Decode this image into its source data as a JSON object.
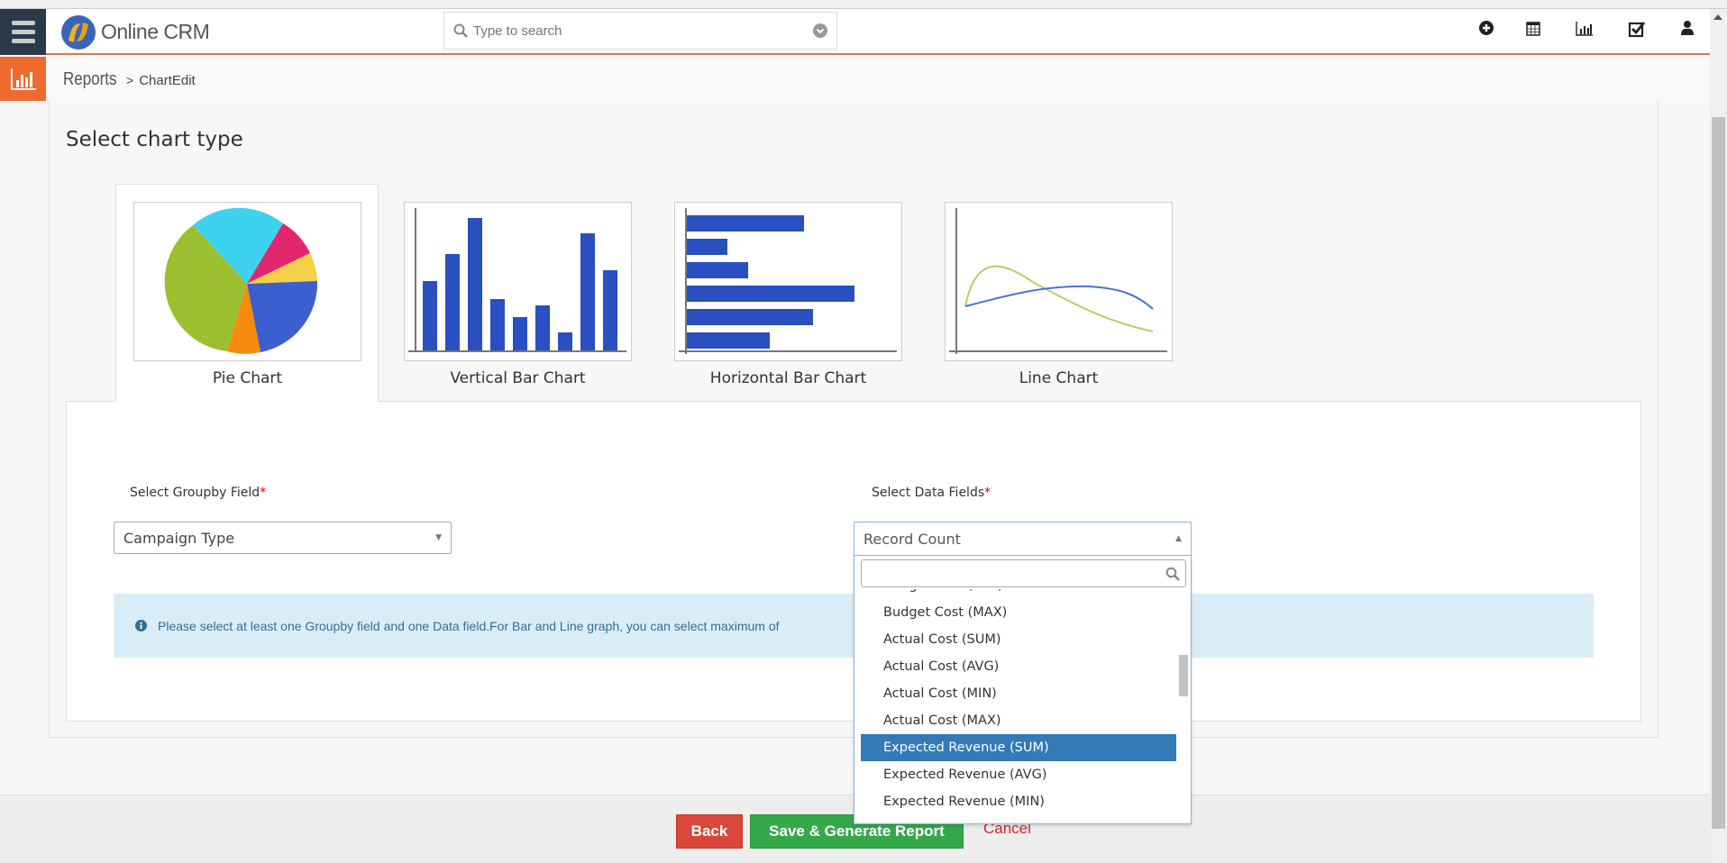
{
  "header": {
    "logo_text": "Online CRM",
    "search_placeholder": "Type to search",
    "icons": [
      "plus-circle-icon",
      "calendar-icon",
      "bar-chart-icon",
      "checkbox-icon",
      "user-icon"
    ]
  },
  "breadcrumb": {
    "root": "Reports",
    "separator": ">",
    "current": "ChartEdit"
  },
  "page": {
    "title": "Select chart type"
  },
  "chart_types": [
    {
      "label": "Pie Chart",
      "active": true
    },
    {
      "label": "Vertical Bar Chart",
      "active": false
    },
    {
      "label": "Horizontal Bar Chart",
      "active": false
    },
    {
      "label": "Line Chart",
      "active": false
    }
  ],
  "form": {
    "groupby_label": "Select Groupby Field",
    "groupby_value": "Campaign Type",
    "data_label": "Select Data Fields",
    "data_value": "Record Count",
    "required_mark": "*",
    "search_value": "",
    "options": [
      "Budget Cost (MIN)",
      "Budget Cost (MAX)",
      "Actual Cost (SUM)",
      "Actual Cost (AVG)",
      "Actual Cost (MIN)",
      "Actual Cost (MAX)",
      "Expected Revenue (SUM)",
      "Expected Revenue (AVG)",
      "Expected Revenue (MIN)"
    ],
    "highlighted_option": "Expected Revenue (SUM)"
  },
  "alert": {
    "text": "Please select at least one Groupby field and one Data field.For Bar and Line graph, you can select maximum of"
  },
  "footer": {
    "back": "Back",
    "save": "Save & Generate Report",
    "cancel": "Cancel"
  },
  "colors": {
    "accent": "#ef6a2e",
    "sidebar": "#2b3a4a",
    "back": "#d9473a",
    "save": "#35a84a",
    "highlight": "#337ab7"
  }
}
